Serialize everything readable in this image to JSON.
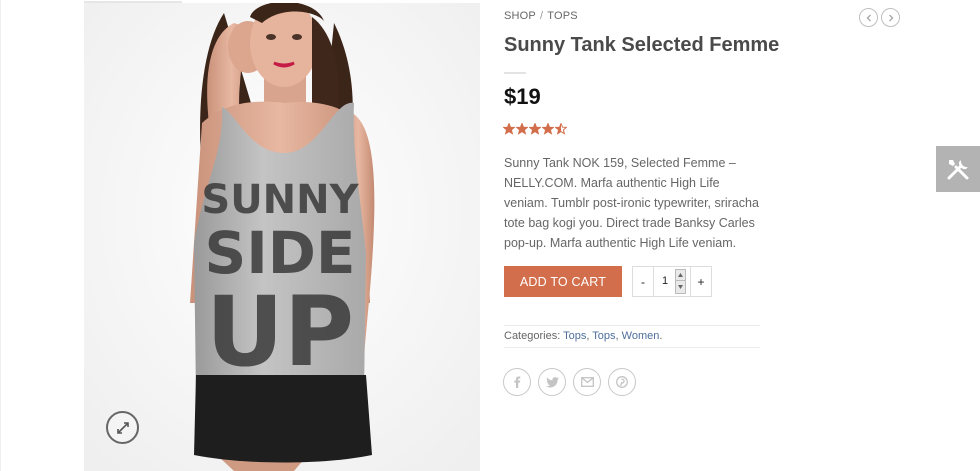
{
  "breadcrumb": {
    "shop": "SHOP",
    "separator": "/",
    "category": "TOPS"
  },
  "nav": {
    "prev_icon": "chevron-left-icon",
    "next_icon": "chevron-right-icon"
  },
  "product": {
    "title": "Sunny Tank Selected Femme",
    "price": "$19",
    "rating": 4.5,
    "rating_max": 5,
    "rating_color": "#d26e4b",
    "description": "Sunny Tank NOK 159, Selected Femme – NELLY.COM. Marfa authentic High Life veniam. Tumblr post-ironic typewriter, sriracha tote bag kogi you. Direct trade Banksy Carles pop-up. Marfa authentic High Life veniam.",
    "image": {
      "print_line1": "SUNNY",
      "print_line2": "SIDE",
      "print_line3": "UP"
    }
  },
  "cart": {
    "add_label": "ADD TO CART",
    "button_color": "#d26e4b",
    "minus": "-",
    "plus": "+",
    "quantity": "1"
  },
  "categories": {
    "label": "Categories:",
    "items": [
      "Tops",
      "Tops",
      "Women"
    ],
    "sep": ", ",
    "end": "."
  },
  "share": {
    "icons": [
      "facebook-icon",
      "twitter-icon",
      "email-icon",
      "pinterest-icon"
    ]
  },
  "tools_tab": {
    "icon": "tools-icon",
    "color": "#b3b3b3"
  },
  "zoom": {
    "icon": "expand-icon"
  }
}
